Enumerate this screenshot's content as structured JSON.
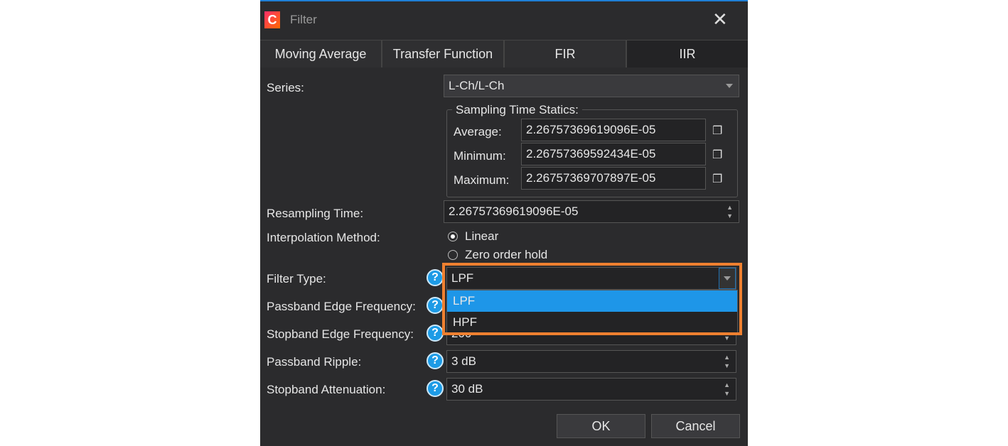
{
  "window": {
    "title": "Filter",
    "logo": "C",
    "close_icon": "close-icon"
  },
  "tabs": [
    {
      "label": "Moving Average"
    },
    {
      "label": "Transfer Function"
    },
    {
      "label": "FIR"
    },
    {
      "label": "IIR",
      "active": true
    }
  ],
  "series": {
    "label": "Series:",
    "value": "L-Ch/L-Ch"
  },
  "sampling": {
    "title": "Sampling Time Statics:",
    "average_label": "Average:",
    "average": "2.26757369619096E-05",
    "minimum_label": "Minimum:",
    "minimum": "2.26757369592434E-05",
    "maximum_label": "Maximum:",
    "maximum": "2.26757369707897E-05"
  },
  "resampling": {
    "label": "Resampling Time:",
    "value": "2.26757369619096E-05"
  },
  "interpolation": {
    "label": "Interpolation Method:",
    "options": [
      "Linear",
      "Zero order hold"
    ],
    "selected": "Linear"
  },
  "filter_type": {
    "label": "Filter Type:",
    "value": "LPF",
    "options": [
      "LPF",
      "HPF"
    ],
    "highlighted": "LPF"
  },
  "passband_edge": {
    "label": "Passband Edge Frequency:"
  },
  "stopband_edge": {
    "label": "Stopband Edge Frequency:",
    "value": "200"
  },
  "passband_ripple": {
    "label": "Passband Ripple:",
    "value": "3 dB"
  },
  "stopband_atten": {
    "label": "Stopband Attenuation:",
    "value": "30 dB"
  },
  "buttons": {
    "ok": "OK",
    "cancel": "Cancel"
  },
  "colors": {
    "accent": "#1e96e8",
    "highlight": "#ef8030",
    "background": "#2b2b2d"
  }
}
